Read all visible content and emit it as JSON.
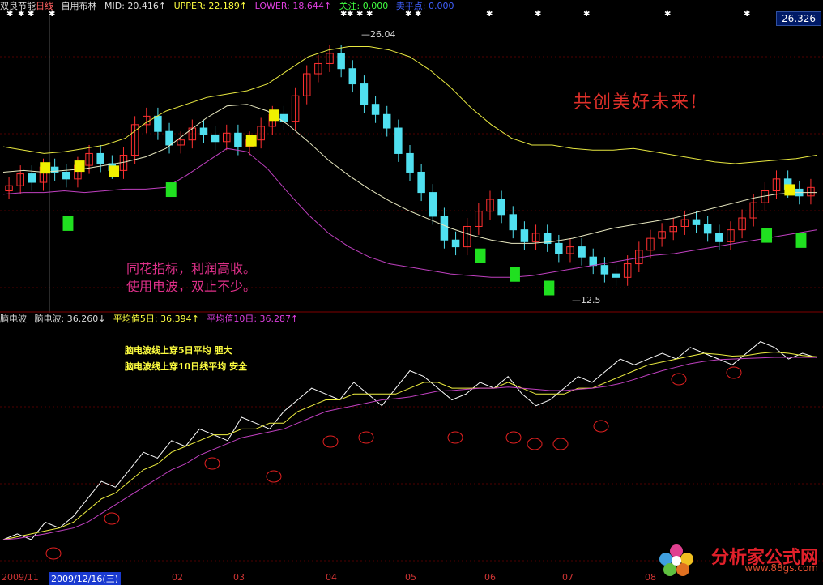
{
  "price_panel": {
    "stock_name": "双良节能",
    "period": "日线",
    "indicator": "自用布林",
    "mid": "MID: 20.416↑",
    "upper": "UPPER: 22.189↑",
    "lower": "LOWER: 18.644↑",
    "focus": "关注: 0.000",
    "sell": "卖平点: 0.000",
    "last_price": "26.326",
    "high_label": "26.04",
    "low_label": "12.5",
    "slogan": "共创美好未来!",
    "ad_line1": "同花指标，利润高收。",
    "ad_line2": "使用电波，双止不少。"
  },
  "osc_panel": {
    "name": "脑电波",
    "value": "脑电波: 36.260↓",
    "ma5": "平均值5日: 36.394↑",
    "ma10": "平均值10日: 36.287↑",
    "note1": "脑电波线上穿5日平均   胆大",
    "note2": "脑电波线上穿10日线平均 安全"
  },
  "x_axis": {
    "labels": [
      "2009/11",
      "2009/12/16(三)",
      "02",
      "03",
      "04",
      "05",
      "06",
      "07",
      "08"
    ]
  },
  "logo": {
    "title": "分析家公式网",
    "url": "www.88gs.com"
  },
  "colors": {
    "upper": "#e8e840",
    "mid": "#e8e8c0",
    "lower": "#c040c0",
    "up": "#ff3030",
    "down": "#50e0f0",
    "buy": "#f0f000",
    "sell": "#20e020"
  },
  "chart_data": [
    {
      "type": "candlestick",
      "title": "双良节能 日线",
      "series": [
        {
          "name": "close",
          "values": [
            18.2,
            18.9,
            18.4,
            19.3,
            19.0,
            18.6,
            19.4,
            20.1,
            19.5,
            19.1,
            20.0,
            21.8,
            22.3,
            21.4,
            20.6,
            20.9,
            21.6,
            21.2,
            20.8,
            21.3,
            20.5,
            20.9,
            21.7,
            22.4,
            22.0,
            23.5,
            24.8,
            25.4,
            26.0,
            25.1,
            24.2,
            23.0,
            22.4,
            21.6,
            20.1,
            19.0,
            17.8,
            16.4,
            15.0,
            14.6,
            15.8,
            16.7,
            17.4,
            16.5,
            15.6,
            14.9,
            15.4,
            14.8,
            14.2,
            14.6,
            14.0,
            13.5,
            13.0,
            12.8,
            13.6,
            14.4,
            15.1,
            15.5,
            15.8,
            16.2,
            15.9,
            15.4,
            14.9,
            15.6,
            16.3,
            17.2,
            17.9,
            18.6,
            18.0,
            17.6,
            18.1
          ]
        },
        {
          "name": "UPPER",
          "values": [
            20.5,
            20.3,
            20.1,
            20.2,
            20.4,
            20.6,
            21.0,
            21.9,
            22.6,
            23.0,
            23.4,
            23.6,
            23.8,
            24.2,
            25.0,
            25.8,
            26.2,
            26.4,
            26.4,
            26.2,
            25.8,
            25.0,
            24.0,
            22.8,
            21.8,
            21.0,
            20.6,
            20.6,
            20.4,
            20.3,
            20.3,
            20.4,
            20.2,
            20.0,
            19.8,
            19.6,
            19.5,
            19.6,
            19.7,
            19.8,
            20.0
          ]
        },
        {
          "name": "MID",
          "values": [
            19.0,
            19.1,
            19.0,
            19.1,
            19.2,
            19.4,
            19.6,
            19.9,
            20.4,
            21.3,
            22.2,
            22.9,
            23.0,
            22.6,
            21.8,
            20.8,
            19.7,
            18.8,
            18.0,
            17.3,
            16.7,
            16.2,
            15.7,
            15.3,
            15.0,
            14.8,
            14.8,
            14.9,
            15.1,
            15.4,
            15.7,
            15.9,
            16.1,
            16.3,
            16.6,
            16.9,
            17.2,
            17.5,
            17.7,
            17.8,
            17.8
          ]
        },
        {
          "name": "LOWER",
          "values": [
            17.7,
            17.8,
            17.8,
            17.9,
            17.8,
            17.9,
            18.0,
            18.0,
            18.1,
            18.8,
            19.6,
            20.4,
            20.2,
            19.2,
            17.8,
            16.5,
            15.4,
            14.6,
            14.0,
            13.6,
            13.4,
            13.2,
            13.0,
            12.9,
            12.8,
            12.8,
            12.9,
            13.1,
            13.3,
            13.5,
            13.7,
            13.9,
            14.1,
            14.2,
            14.4,
            14.6,
            14.8,
            15.0,
            15.2,
            15.4,
            15.6
          ]
        }
      ],
      "last": 26.326,
      "high": 26.04,
      "low": 12.5
    },
    {
      "type": "line",
      "title": "脑电波",
      "series": [
        {
          "name": "脑电波",
          "values": [
            5,
            6,
            5,
            8,
            7,
            9,
            12,
            15,
            14,
            17,
            20,
            19,
            22,
            21,
            24,
            23,
            22,
            26,
            25,
            24,
            27,
            29,
            31,
            30,
            29,
            32,
            30,
            28,
            31,
            34,
            33,
            31,
            29,
            30,
            32,
            31,
            33,
            30,
            28,
            29,
            31,
            33,
            32,
            34,
            36,
            35,
            36,
            37,
            36,
            38,
            37,
            36,
            35,
            37,
            39,
            38,
            36,
            37,
            36.26
          ]
        },
        {
          "name": "平均值5日",
          "values": [
            5,
            5.5,
            6,
            6.5,
            7,
            8,
            10,
            12,
            13,
            15,
            17,
            18,
            20,
            21,
            22,
            23,
            23,
            24,
            24,
            25,
            25,
            27,
            28,
            29,
            29,
            30,
            30,
            30,
            30,
            31,
            32,
            32,
            31,
            31,
            31,
            31,
            32,
            31,
            30,
            30,
            30,
            31,
            31,
            32,
            33,
            34,
            35,
            35.5,
            36,
            36.5,
            37,
            36.8,
            36.5,
            36.6,
            37,
            37.2,
            37,
            36.6,
            36.394
          ]
        },
        {
          "name": "平均值10日",
          "values": [
            5,
            5.2,
            5.6,
            6,
            6.5,
            7,
            8,
            9.5,
            11,
            12.5,
            14,
            15.5,
            17,
            18,
            19.5,
            20.5,
            21.5,
            22.5,
            23,
            23.5,
            24,
            25,
            26,
            27,
            27.5,
            28,
            28.5,
            29,
            29.2,
            29.5,
            30,
            30.5,
            30.6,
            30.8,
            31,
            31,
            31.2,
            31,
            30.8,
            30.6,
            30.6,
            30.8,
            31,
            31.3,
            31.8,
            32.5,
            33.3,
            34,
            34.6,
            35.2,
            35.6,
            35.9,
            36,
            36.1,
            36.2,
            36.3,
            36.3,
            36.3,
            36.287
          ]
        }
      ]
    }
  ]
}
